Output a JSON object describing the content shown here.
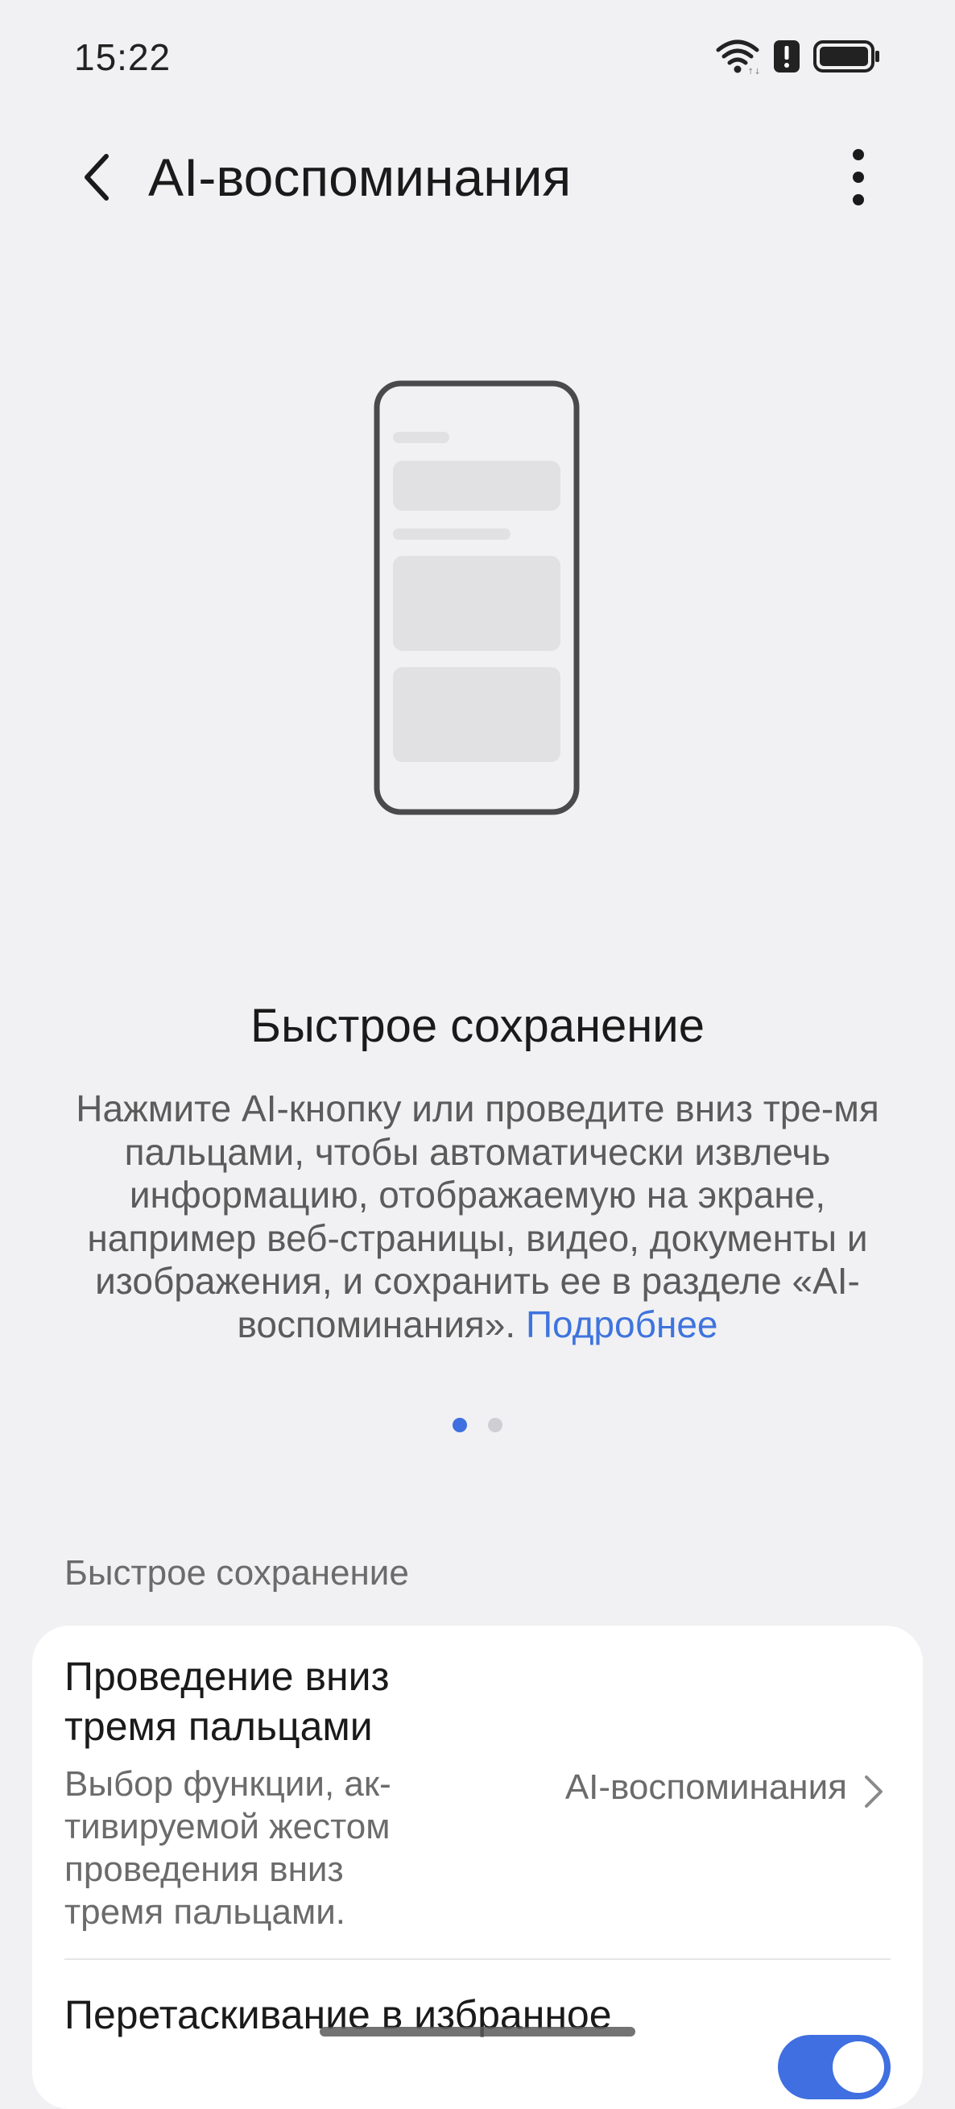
{
  "status_bar": {
    "time": "15:22",
    "icons": [
      "wifi-icon",
      "alert-icon",
      "battery-icon"
    ]
  },
  "app_bar": {
    "title": "AI-воспоминания",
    "back_icon": "back-arrow-icon",
    "more_icon": "more-vertical-icon"
  },
  "intro": {
    "heading": "Быстрое сохранение",
    "description": "Нажмите AI-кнопку или проведите вниз тре-мя пальцами, чтобы автоматически извлечь информацию, отображаемую на экране, например веб-страницы, видео, документы и изображения, и сохранить ее в разделе «AI-воспоминания».",
    "more_link": "Подробнее",
    "page_count": 2,
    "active_page": 1
  },
  "settings": {
    "section_label": "Быстрое сохранение",
    "three_finger_swipe": {
      "title": "Проведение вниз тремя пальцами",
      "description": "Выбор функции, ак-тивируемой жестом проведения вниз тремя пальцами.",
      "value": "AI-воспоминания"
    },
    "drag_to_favorites": {
      "title": "Перетаскивание в избранное",
      "enabled": true
    }
  },
  "colors": {
    "background": "#f1f1f3",
    "accent": "#3f6fe0",
    "link": "#3f74dd",
    "card": "#ffffff"
  }
}
